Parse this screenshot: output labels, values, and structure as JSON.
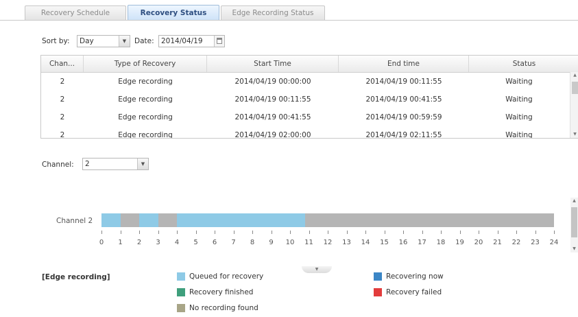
{
  "tabs": [
    {
      "label": "Recovery Schedule",
      "active": false
    },
    {
      "label": "Recovery Status",
      "active": true
    },
    {
      "label": "Edge Recording Status",
      "active": false
    }
  ],
  "toolbar": {
    "sort_label": "Sort by:",
    "sort_value": "Day",
    "date_label": "Date:",
    "date_value": "2014/04/19"
  },
  "table": {
    "columns": [
      "Chan...",
      "Type of Recovery",
      "Start Time",
      "End time",
      "Status"
    ],
    "rows": [
      [
        "2",
        "Edge recording",
        "2014/04/19 00:00:00",
        "2014/04/19 00:11:55",
        "Waiting"
      ],
      [
        "2",
        "Edge recording",
        "2014/04/19 00:11:55",
        "2014/04/19 00:41:55",
        "Waiting"
      ],
      [
        "2",
        "Edge recording",
        "2014/04/19 00:41:55",
        "2014/04/19 00:59:59",
        "Waiting"
      ],
      [
        "2",
        "Edge recording",
        "2014/04/19 02:00:00",
        "2014/04/19 02:11:55",
        "Waiting"
      ]
    ]
  },
  "channel": {
    "label": "Channel:",
    "value": "2"
  },
  "timeline": {
    "row_label": "Channel 2",
    "hours": [
      "0",
      "1",
      "2",
      "3",
      "4",
      "5",
      "6",
      "7",
      "8",
      "9",
      "10",
      "11",
      "12",
      "13",
      "14",
      "15",
      "16",
      "17",
      "18",
      "19",
      "20",
      "21",
      "22",
      "23",
      "24"
    ],
    "segments": [
      {
        "start": 0,
        "end": 1,
        "state": "queued"
      },
      {
        "start": 1,
        "end": 2,
        "state": "none"
      },
      {
        "start": 2,
        "end": 3,
        "state": "queued"
      },
      {
        "start": 3,
        "end": 4,
        "state": "none"
      },
      {
        "start": 4,
        "end": 10.8,
        "state": "queued"
      },
      {
        "start": 10.8,
        "end": 24,
        "state": "none"
      }
    ]
  },
  "legend": {
    "title": "[Edge recording]",
    "items": [
      {
        "key": "queued",
        "label": "Queued for recovery",
        "color": "#8ecae6"
      },
      {
        "key": "finished",
        "label": "Recovery finished",
        "color": "#3f9f7c"
      },
      {
        "key": "none",
        "label": "No recording found",
        "color": "#a8a587"
      },
      {
        "key": "recovering",
        "label": "Recovering now",
        "color": "#3b86c6"
      },
      {
        "key": "failed",
        "label": "Recovery failed",
        "color": "#e23c3c"
      }
    ]
  },
  "colors": {
    "queued_bar": "#8ecae6",
    "none_bar": "#b5b5b5"
  }
}
